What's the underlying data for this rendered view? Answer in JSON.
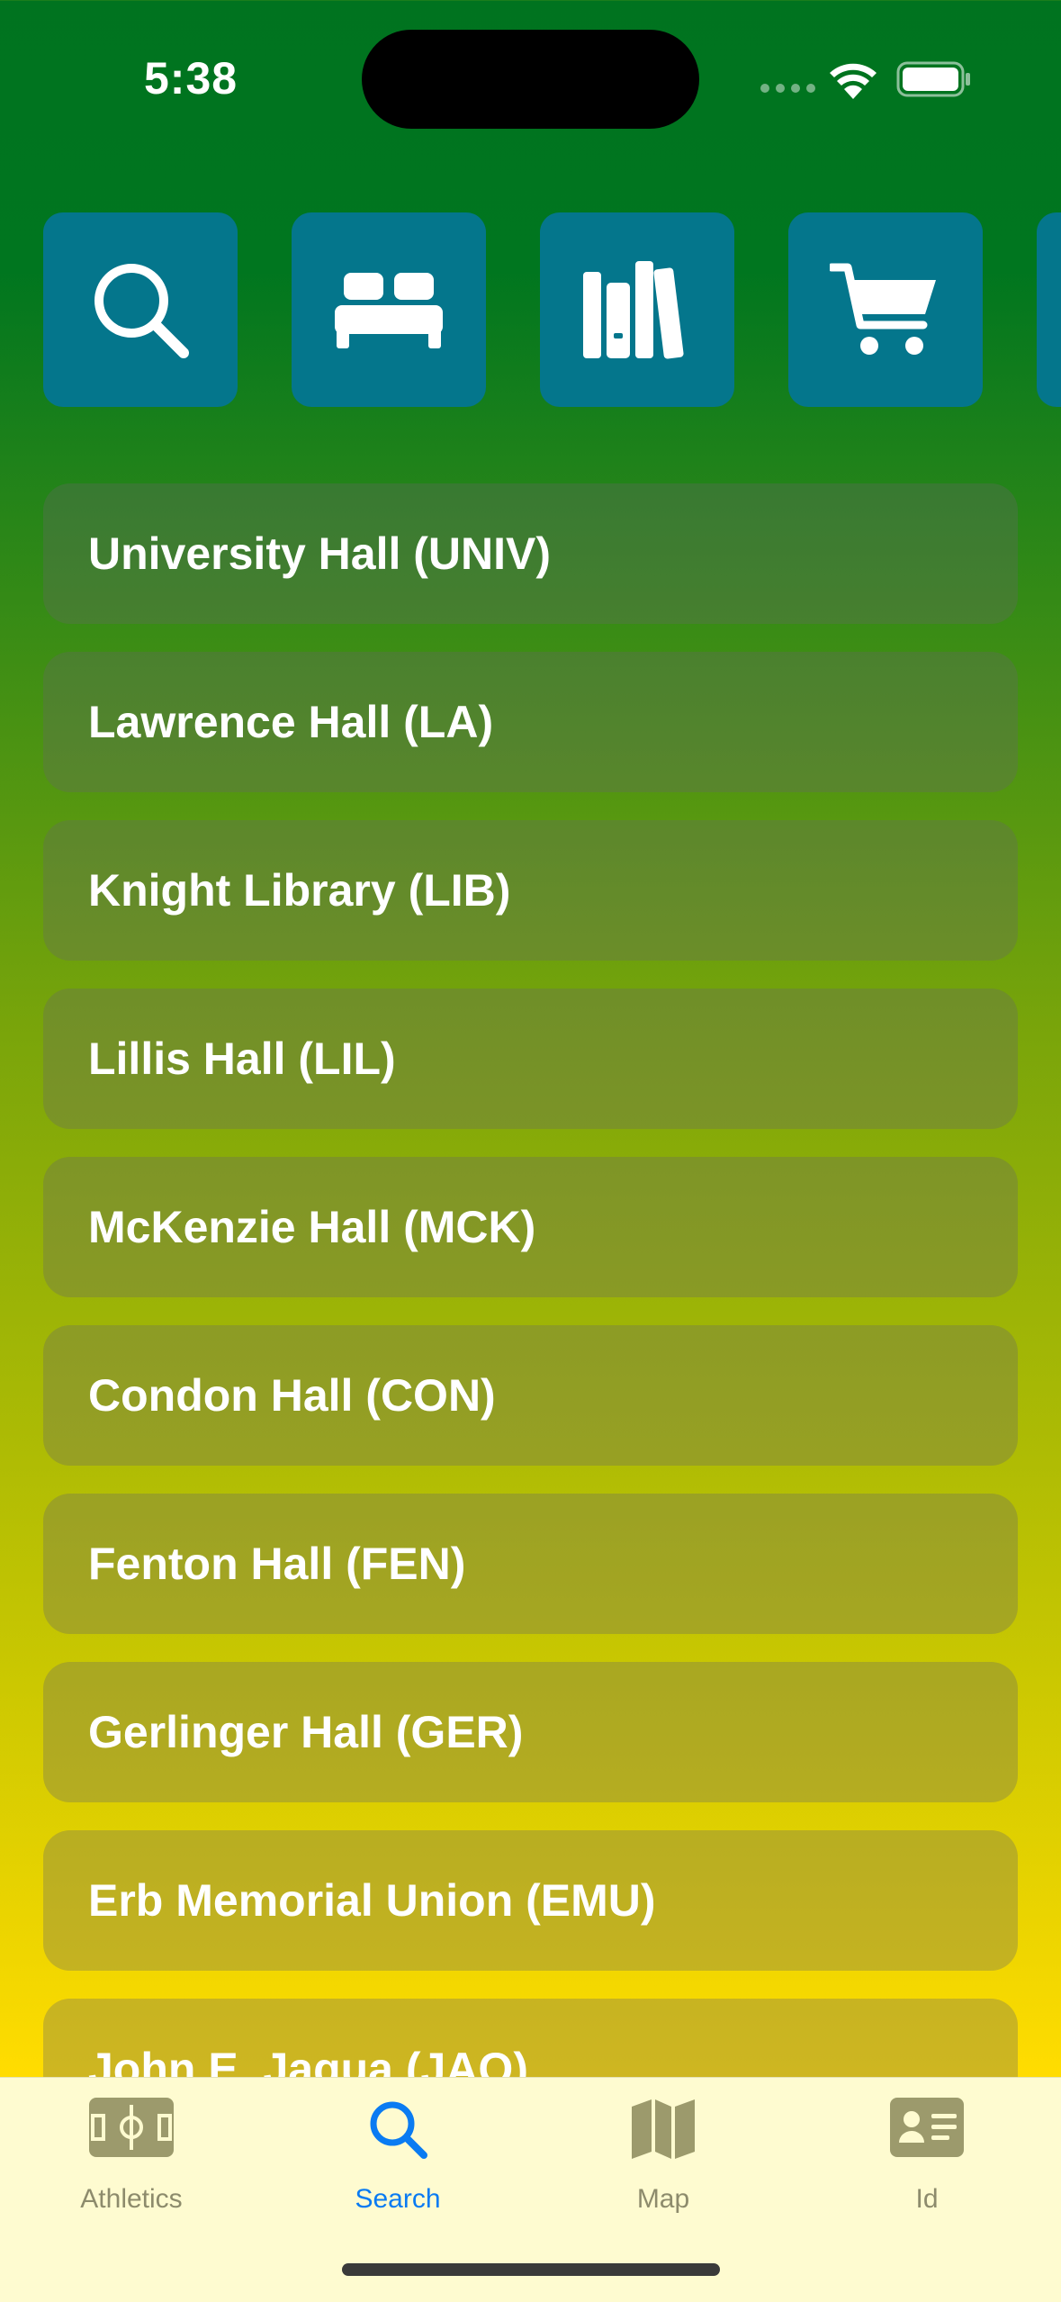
{
  "status_bar": {
    "time": "5:38"
  },
  "categories": [
    {
      "icon": "search-icon",
      "name": "search"
    },
    {
      "icon": "bed-icon",
      "name": "housing"
    },
    {
      "icon": "books-icon",
      "name": "libraries"
    },
    {
      "icon": "cart-icon",
      "name": "shopping"
    }
  ],
  "buildings": [
    {
      "label": "University Hall (UNIV)"
    },
    {
      "label": "Lawrence Hall (LA)"
    },
    {
      "label": "Knight Library (LIB)"
    },
    {
      "label": "Lillis Hall (LIL)"
    },
    {
      "label": "McKenzie Hall (MCK)"
    },
    {
      "label": "Condon Hall (CON)"
    },
    {
      "label": "Fenton Hall (FEN)"
    },
    {
      "label": "Gerlinger Hall (GER)"
    },
    {
      "label": "Erb Memorial Union (EMU)"
    },
    {
      "label": "John E. Jaqua (JAQ)"
    }
  ],
  "tab_bar": {
    "tabs": [
      {
        "label": "Athletics",
        "icon": "field-icon"
      },
      {
        "label": "Search",
        "icon": "search-icon",
        "active": true
      },
      {
        "label": "Map",
        "icon": "map-icon"
      },
      {
        "label": "Id",
        "icon": "id-card-icon"
      }
    ]
  },
  "colors": {
    "category_button": "#04768c",
    "active_tab": "#0a7bf2",
    "inactive_tab": "#8d8b6c",
    "tab_bar_bg": "#fefbd0"
  }
}
